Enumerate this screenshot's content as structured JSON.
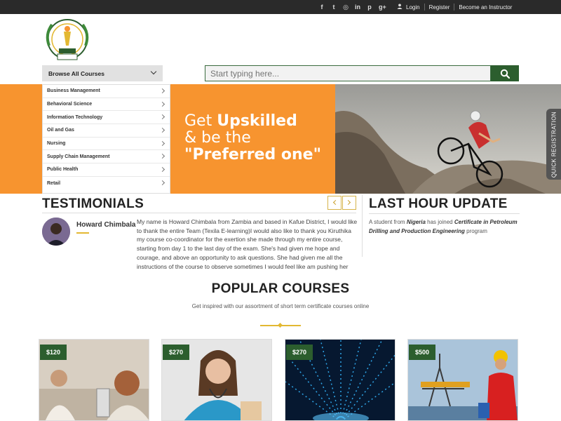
{
  "topbar": {
    "social_icons": [
      "facebook-icon",
      "twitter-icon",
      "whatsapp-icon",
      "linkedin-icon",
      "pinterest-icon",
      "google-plus-icon"
    ],
    "login": "Login",
    "register": "Register",
    "instructor": "Become an Instructor"
  },
  "header": {
    "browse_label": "Browse All Courses",
    "search_placeholder": "Start typing here..."
  },
  "categories": [
    "Business Management",
    "Behavioral Science",
    "Information Technology",
    "Oil and Gas",
    "Nursing",
    "Supply Chain Management",
    "Public Health",
    "Retail"
  ],
  "banner": {
    "line1_pre": "Get ",
    "line1_bold": "Upskilled",
    "line2": "& be the",
    "line3": "\"Preferred one\"",
    "quick_registration": "QUICK REGISTRATION"
  },
  "testimonials": {
    "heading": "TESTIMONIALS",
    "name": "Howard Chimbala",
    "text": "My name is Howard Chimbala from Zambia and based in Kafue District, I would like to thank the entire Team (Texila E-learning)I would also like to thank you Kiruthika my course co-coordinator for the exertion she made through my entire course, starting from day 1 to the last day of the exam. She's had given me hope and courage, and above an opportunity to ask questions. She had given me all the instructions of the course to observe sometimes I would feel like am pushing her"
  },
  "update": {
    "heading": "LAST HOUR UPDATE",
    "pre": "A student from ",
    "country": "Nigeria",
    "mid": " has joined ",
    "course": "Certificate in Petroleum Drilling and Production Engineering",
    "post": " program"
  },
  "popular": {
    "heading": "POPULAR COURSES",
    "subtitle": "Get inspired with our assortment of short term certificate courses online",
    "cards": [
      {
        "price": "$120"
      },
      {
        "price": "$270"
      },
      {
        "price": "$270"
      },
      {
        "price": "$500"
      }
    ]
  },
  "colors": {
    "brand_green": "#2c5e2e",
    "banner_orange": "#f7942f",
    "gold": "#e3b832"
  }
}
